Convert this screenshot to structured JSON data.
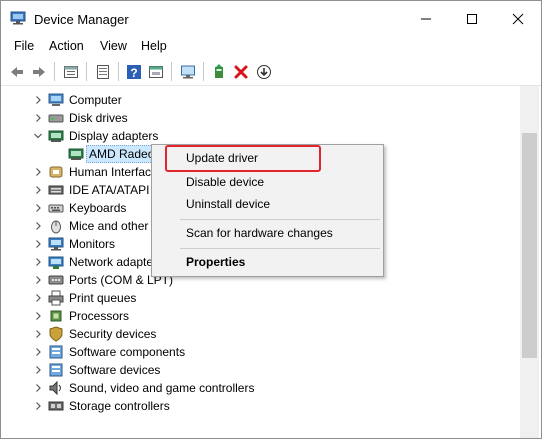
{
  "window": {
    "title": "Device Manager"
  },
  "menu": [
    "File",
    "Action",
    "View",
    "Help"
  ],
  "toolbar": [
    "back-icon",
    "forward-icon",
    "show-hide-icon",
    "properties-icon",
    "help-icon",
    "update-icon",
    "monitor-scan-icon",
    "add-driver-icon",
    "remove-icon",
    "download-icon"
  ],
  "tree": [
    {
      "label": "Computer",
      "icon": "computer-icon",
      "expanded": false
    },
    {
      "label": "Disk drives",
      "icon": "disk-icon",
      "expanded": false
    },
    {
      "label": "Display adapters",
      "icon": "display-adapter-icon",
      "expanded": true
    },
    {
      "label": "AMD Radeo",
      "icon": "display-adapter-icon",
      "child": true,
      "selected": true
    },
    {
      "label": "Human Interfac",
      "icon": "hid-icon",
      "expanded": false
    },
    {
      "label": "IDE ATA/ATAPI c",
      "icon": "ide-icon",
      "expanded": false
    },
    {
      "label": "Keyboards",
      "icon": "keyboard-icon",
      "expanded": false
    },
    {
      "label": "Mice and other",
      "icon": "mouse-icon",
      "expanded": false
    },
    {
      "label": "Monitors",
      "icon": "monitor-icon",
      "expanded": false
    },
    {
      "label": "Network adapte",
      "icon": "network-icon",
      "expanded": false
    },
    {
      "label": "Ports (COM & LPT)",
      "icon": "port-icon",
      "expanded": false
    },
    {
      "label": "Print queues",
      "icon": "printer-icon",
      "expanded": false
    },
    {
      "label": "Processors",
      "icon": "processor-icon",
      "expanded": false
    },
    {
      "label": "Security devices",
      "icon": "security-icon",
      "expanded": false
    },
    {
      "label": "Software components",
      "icon": "software-icon",
      "expanded": false
    },
    {
      "label": "Software devices",
      "icon": "software-icon",
      "expanded": false
    },
    {
      "label": "Sound, video and game controllers",
      "icon": "sound-icon",
      "expanded": false
    },
    {
      "label": "Storage controllers",
      "icon": "storage-icon",
      "expanded": false
    }
  ],
  "context_menu": {
    "items": [
      {
        "label": "Update driver",
        "bold": false
      },
      {
        "label": "Disable device",
        "bold": false
      },
      {
        "label": "Uninstall device",
        "bold": false
      },
      {
        "label": "Scan for hardware changes",
        "bold": false
      },
      {
        "label": "Properties",
        "bold": true
      }
    ]
  },
  "colors": {
    "highlight_border": "#e0262c",
    "selection": "#cce8ff"
  }
}
